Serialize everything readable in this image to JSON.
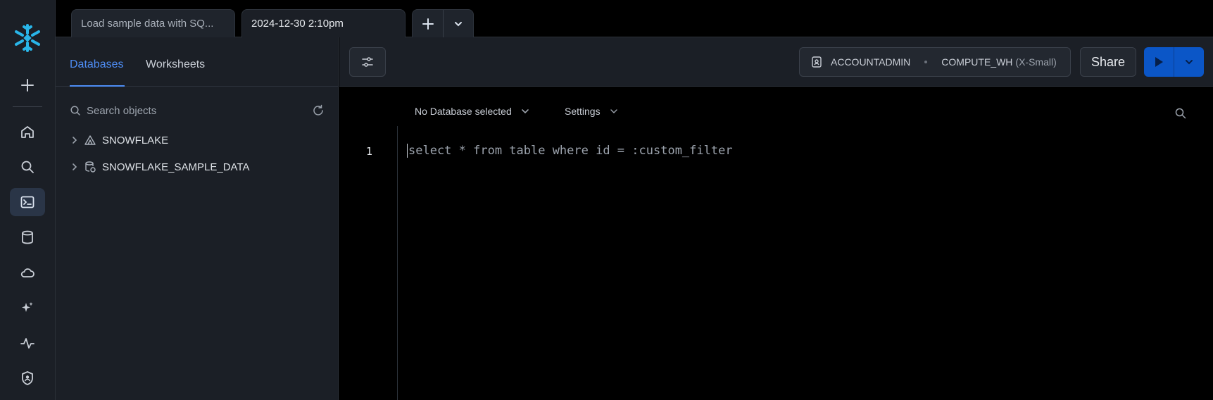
{
  "tabs": {
    "items": [
      {
        "label": "Load sample data with SQ..."
      },
      {
        "label": "2024-12-30 2:10pm"
      }
    ]
  },
  "browser": {
    "tab_databases": "Databases",
    "tab_worksheets": "Worksheets",
    "search_placeholder": "Search objects",
    "tree": [
      {
        "label": "SNOWFLAKE",
        "icon": "share-icon"
      },
      {
        "label": "SNOWFLAKE_SAMPLE_DATA",
        "icon": "database-shared-icon"
      }
    ]
  },
  "toolbar": {
    "role": "ACCOUNTADMIN",
    "warehouse": "COMPUTE_WH",
    "warehouse_size": "(X-Small)",
    "share_label": "Share"
  },
  "editor": {
    "database_selector": "No Database selected",
    "settings_label": "Settings",
    "line_number": "1",
    "code": "select * from table where id = :custom_filter"
  },
  "colors": {
    "accent": "#4e8df5",
    "run_button": "#0b56c7",
    "logo": "#29b5e8"
  }
}
